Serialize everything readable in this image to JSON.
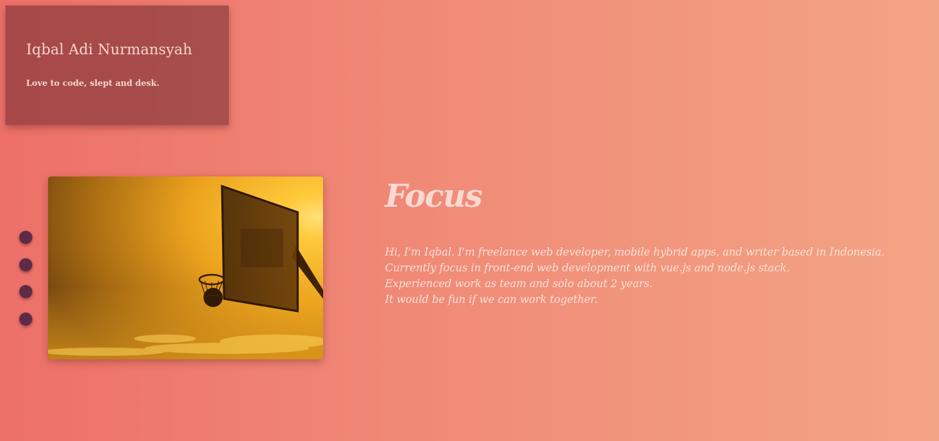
{
  "profile": {
    "name": "Iqbal Adi Nurmansyah",
    "tagline": "Love to code, slept and desk."
  },
  "navigation": {
    "dots": [
      "dot-1",
      "dot-2",
      "dot-3",
      "dot-4"
    ],
    "active_index": 0
  },
  "slide": {
    "image_subject": "basketball-hoop-sunset-photo",
    "title": "Focus",
    "lines": [
      "Hi, I'm Iqbal. I'm freelance web developer, mobile hybrid apps, and writer based in Indonesia.",
      "Currently focus in front-end web development with vue.js and node.js stack.",
      "Experienced work as team and solo about 2 years.",
      "It would be fun if we can work together."
    ]
  },
  "colors": {
    "gradient_start": "#ed7069",
    "gradient_end": "#f3a485",
    "card": "#8e3f3f",
    "dot": "#5e2b47",
    "text_light": "#fbd9d2"
  }
}
